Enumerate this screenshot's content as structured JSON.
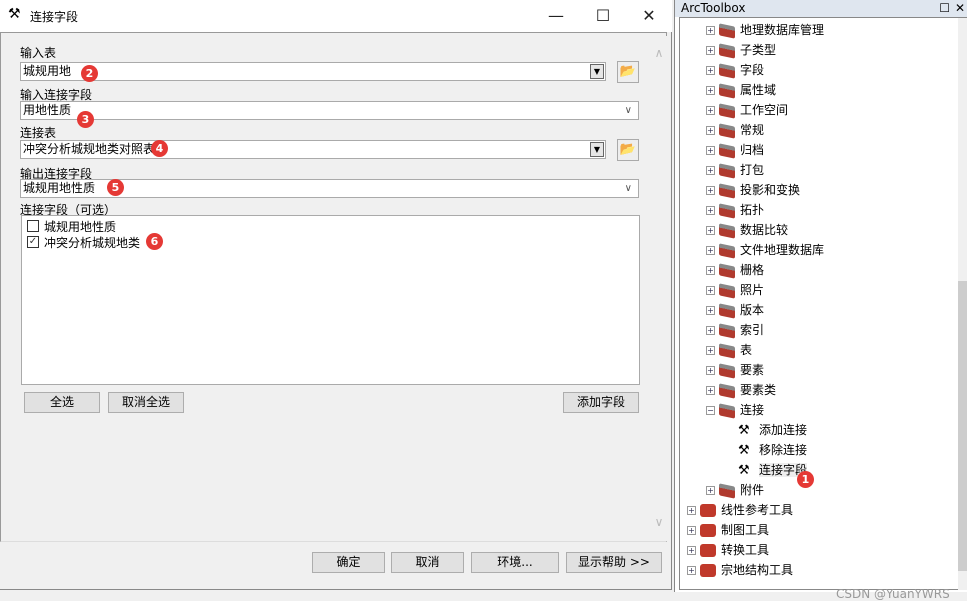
{
  "dialog": {
    "title": "连接字段",
    "icon": "hammer-icon",
    "input_table": {
      "label": "输入表",
      "value": "城规用地"
    },
    "input_join_field": {
      "label": "输入连接字段",
      "value": "用地性质"
    },
    "join_table": {
      "label": "连接表",
      "value": "冲突分析城规地类对照表"
    },
    "output_join_field": {
      "label": "输出连接字段",
      "value": "城规用地性质"
    },
    "join_fields": {
      "label": "连接字段（可选）",
      "items": [
        {
          "label": "城规用地性质",
          "checked": false
        },
        {
          "label": "冲突分析城规地类",
          "checked": true
        }
      ]
    },
    "select_all": "全选",
    "unselect_all": "取消全选",
    "add_field": "添加字段",
    "ok": "确定",
    "cancel": "取消",
    "env": "环境...",
    "show_help": "显示帮助 >>"
  },
  "badges": [
    "1",
    "2",
    "3",
    "4",
    "5",
    "6"
  ],
  "toolbox": {
    "title": "ArcToolbox",
    "sub_items": [
      "地理数据库管理",
      "子类型",
      "字段",
      "属性域",
      "工作空间",
      "常规",
      "归档",
      "打包",
      "投影和变换",
      "拓扑",
      "数据比较",
      "文件地理数据库",
      "栅格",
      "照片",
      "版本",
      "索引",
      "表",
      "要素",
      "要素类",
      "连接"
    ],
    "tools": [
      "添加连接",
      "移除连接",
      "连接字段"
    ],
    "after": "附件",
    "top_items": [
      "线性参考工具",
      "制图工具",
      "转换工具",
      "宗地结构工具"
    ]
  },
  "watermark": "CSDN @YuanYWRS",
  "colors": {
    "badge": "#e53935"
  }
}
